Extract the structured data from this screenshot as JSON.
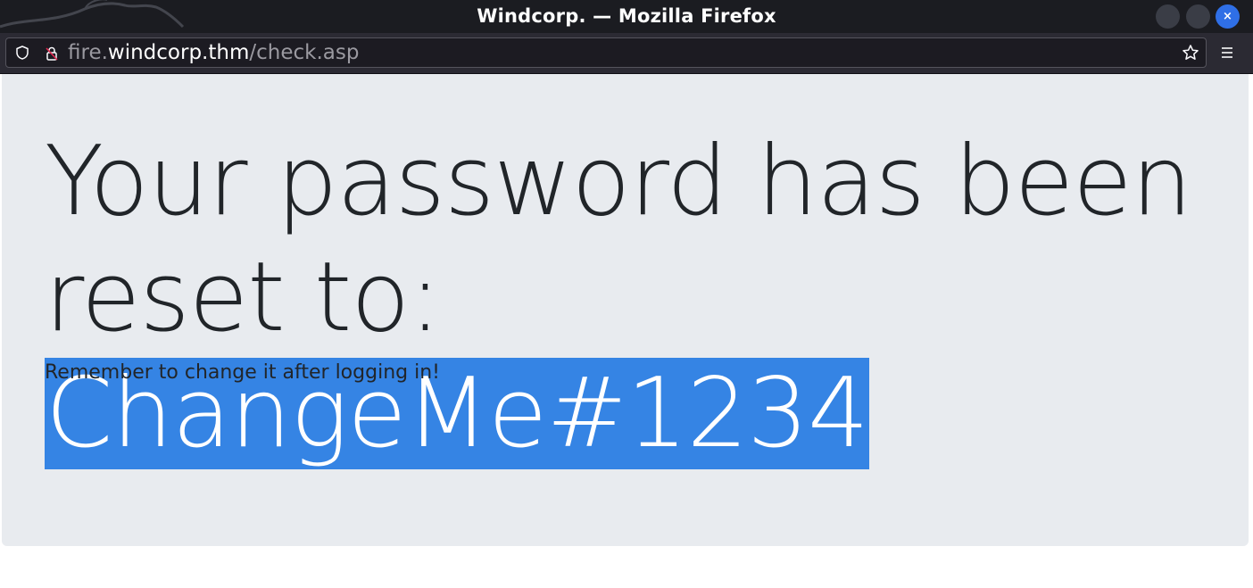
{
  "window": {
    "title": "Windcorp. — Mozilla Firefox",
    "close_glyph": "×"
  },
  "navbar": {
    "url": {
      "subdomain": "fire.",
      "domain": "windcorp.thm",
      "path": "/check.asp"
    },
    "icons": [
      "shield-icon",
      "insecure-lock-icon",
      "bookmark-star-icon",
      "hamburger-menu-icon"
    ]
  },
  "page": {
    "heading_prefix": "Your password has been reset to:",
    "password": "ChangeMe#1234",
    "subtext": "Remember to change it after logging in!"
  },
  "colors": {
    "titlebar": "#1b1c21",
    "navbar": "#2b2a33",
    "urlbar": "#1c1b22",
    "close_button": "#2f6fe6",
    "jumbotron": "#e8ebef",
    "selection": "#3584e4",
    "text": "#212529"
  }
}
